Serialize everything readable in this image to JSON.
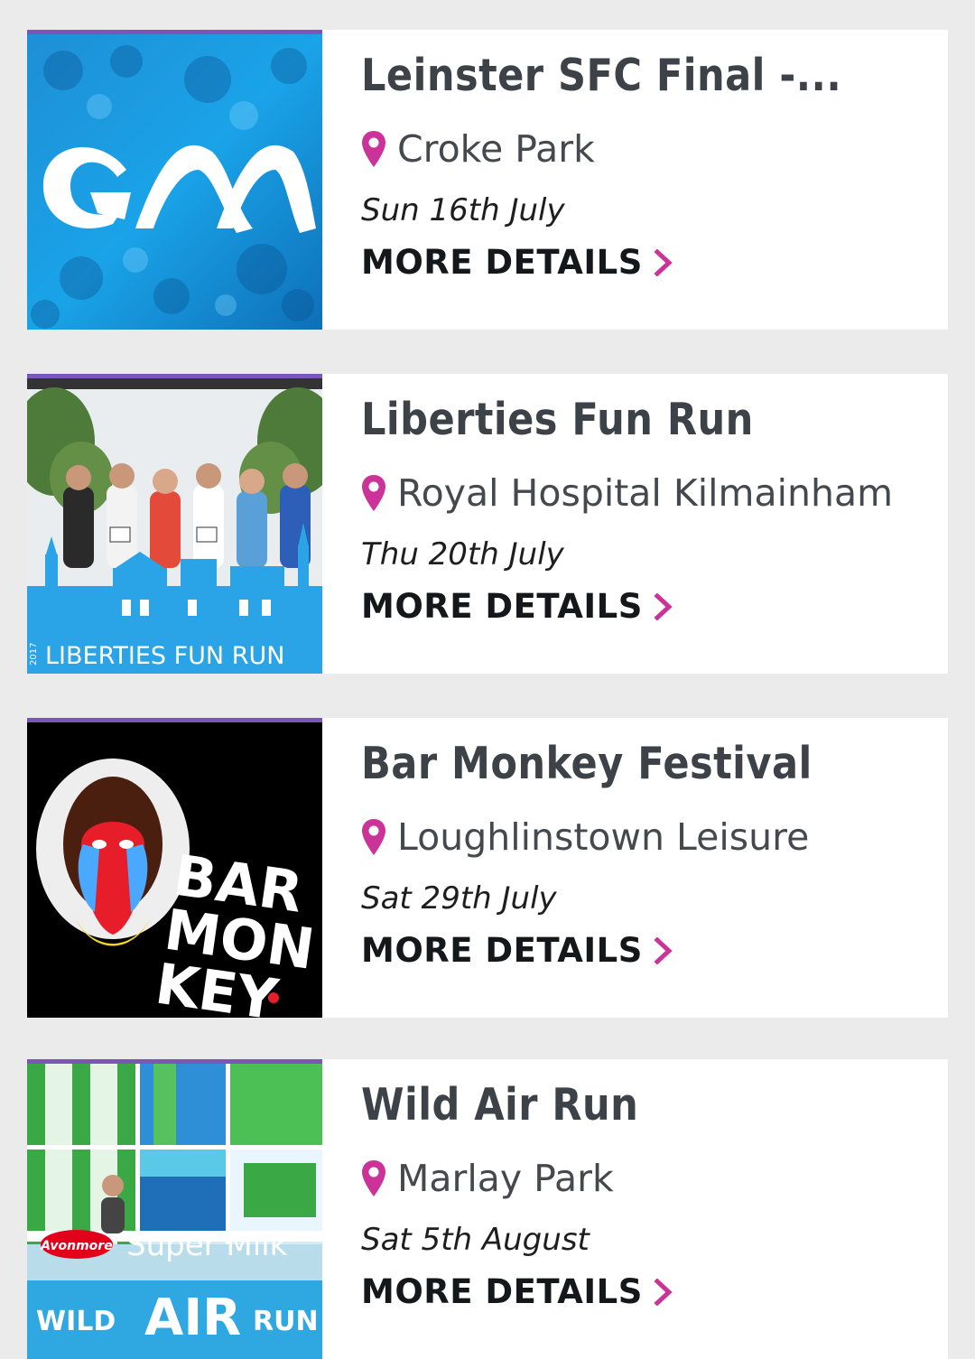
{
  "accent_color": "#cc3399",
  "thumb_border_color": "#7a56b8",
  "events": [
    {
      "title": "Leinster SFC Final -...",
      "venue": "Croke Park",
      "date": "Sun 16th July",
      "more_label": "MORE DETAILS",
      "image": "gaa-logo-crowd-image",
      "image_text": "GAA"
    },
    {
      "title": "Liberties Fun Run",
      "venue": "Royal Hospital Kilmainham",
      "date": "Thu 20th July",
      "more_label": "MORE DETAILS",
      "image": "liberties-fun-run-runners-image",
      "image_text": "LIBERTIES FUN RUN",
      "image_year": "2017"
    },
    {
      "title": "Bar Monkey Festival",
      "venue": "Loughlinstown Leisure",
      "date": "Sat 29th July",
      "more_label": "MORE DETAILS",
      "image": "bar-monkey-mandrill-image",
      "image_text": "BAR MONKEY."
    },
    {
      "title": "Wild Air Run",
      "venue": "Marlay Park",
      "date": "Sat 5th August",
      "more_label": "MORE DETAILS",
      "image": "wild-air-run-inflatables-image",
      "image_text": "Super Milk",
      "image_brand": "Avonmore"
    }
  ]
}
